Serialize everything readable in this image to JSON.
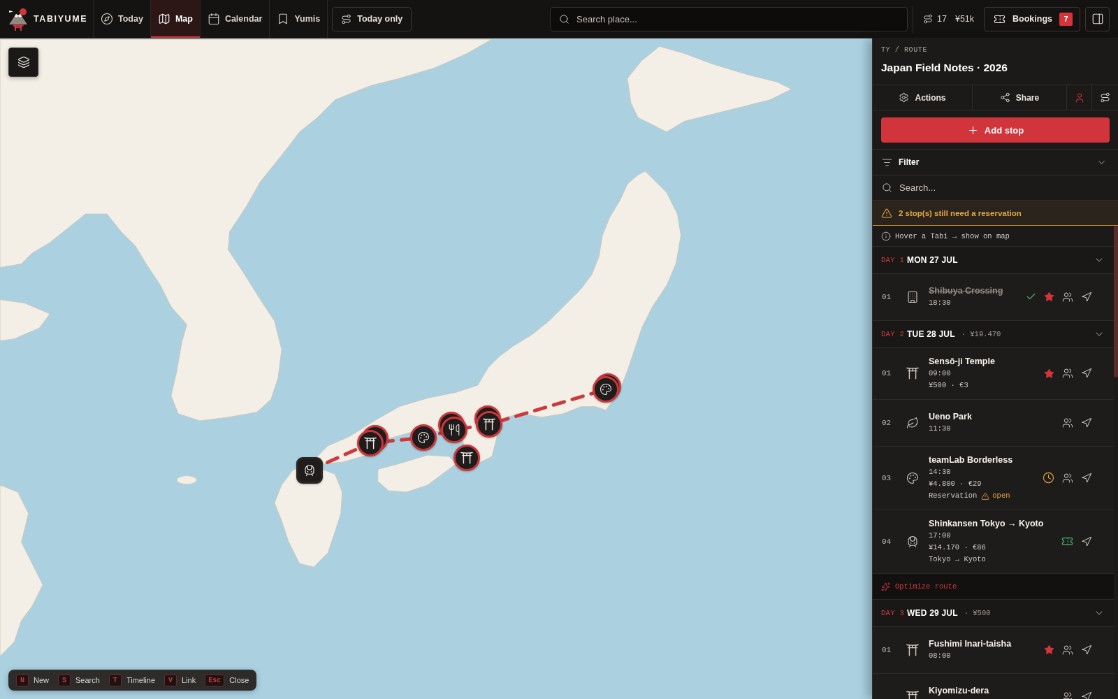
{
  "app": {
    "name": "TABIYUME"
  },
  "nav": [
    {
      "label": "Today",
      "selected": false
    },
    {
      "label": "Map",
      "selected": true
    },
    {
      "label": "Calendar",
      "selected": false
    },
    {
      "label": "Yumis",
      "selected": false
    }
  ],
  "today_only": {
    "label": "Today only"
  },
  "search": {
    "placeholder": "Search place..."
  },
  "stats": {
    "stops": "17",
    "budget": "¥51k"
  },
  "bookings": {
    "label": "Bookings",
    "count": "7"
  },
  "map": {
    "markers": [
      {
        "kind": "train",
        "stacked": false
      },
      {
        "kind": "shrine",
        "stacked": true
      },
      {
        "kind": "art",
        "stacked": false
      },
      {
        "kind": "shrine",
        "stacked": true
      },
      {
        "kind": "food",
        "stacked": true
      },
      {
        "kind": "shrine",
        "stacked": false
      },
      {
        "kind": "art",
        "stacked": true
      }
    ]
  },
  "shortcuts": [
    {
      "key": "N",
      "label": "New"
    },
    {
      "key": "S",
      "label": "Search"
    },
    {
      "key": "T",
      "label": "Timeline"
    },
    {
      "key": "V",
      "label": "Link"
    },
    {
      "key": "Esc",
      "label": "Close"
    }
  ],
  "panel": {
    "breadcrumb": "TY / ROUTE",
    "title": "Japan Field Notes · 2026",
    "actions": [
      {
        "label": "Actions"
      },
      {
        "label": "Share"
      }
    ],
    "add_button": "Add stop",
    "filter": {
      "label": "Filter",
      "expanded": false
    },
    "search": {
      "placeholder": "Search..."
    },
    "warning": "2 stop(s) still need a reservation",
    "hint": "Hover a Tabi → show on map",
    "days": [
      {
        "label": "DAY 1",
        "date": "MON 27 JUL",
        "expanded": true,
        "stops": [
          {
            "number": "01",
            "kind": "building",
            "name": "Shibuya Crossing",
            "time": "18:30",
            "done": true,
            "starred": true,
            "group": true
          }
        ]
      },
      {
        "label": "DAY 2",
        "date": "TUE 28 JUL",
        "total": "· ¥19.470",
        "expanded": true,
        "stops": [
          {
            "number": "01",
            "kind": "shrine",
            "name": "Sensō-ji Temple",
            "time": "09:00",
            "price": "¥500 · €3",
            "done": false,
            "starred": true,
            "group": true
          },
          {
            "number": "02",
            "kind": "park",
            "name": "Ueno Park",
            "time": "11:30",
            "done": false,
            "starred": false,
            "group": true
          },
          {
            "number": "03",
            "kind": "art",
            "name": "teamLab Borderless",
            "time": "14:30",
            "price": "¥4.800 · €29",
            "reservation": {
              "label": "Reservation",
              "status": "open"
            },
            "pending": true,
            "done": false,
            "starred": false,
            "group": true
          },
          {
            "number": "04",
            "kind": "train",
            "name": "Shinkansen Tokyo → Kyoto",
            "time": "17:00",
            "price": "¥14.170 · €86",
            "note": "Tokyo → Kyoto",
            "ticketed": true,
            "done": false,
            "starred": false,
            "group": false
          }
        ],
        "optimize": "Optimize route"
      },
      {
        "label": "DAY 3",
        "date": "WED 29 JUL",
        "total": "· ¥500",
        "expanded": true,
        "stops": [
          {
            "number": "01",
            "kind": "shrine",
            "name": "Fushimi Inari-taisha",
            "time": "08:00",
            "done": false,
            "starred": true,
            "group": true
          },
          {
            "kind": "shrine",
            "name": "Kiyomizu-dera",
            "done": false,
            "starred": false,
            "group": true
          }
        ]
      }
    ]
  }
}
